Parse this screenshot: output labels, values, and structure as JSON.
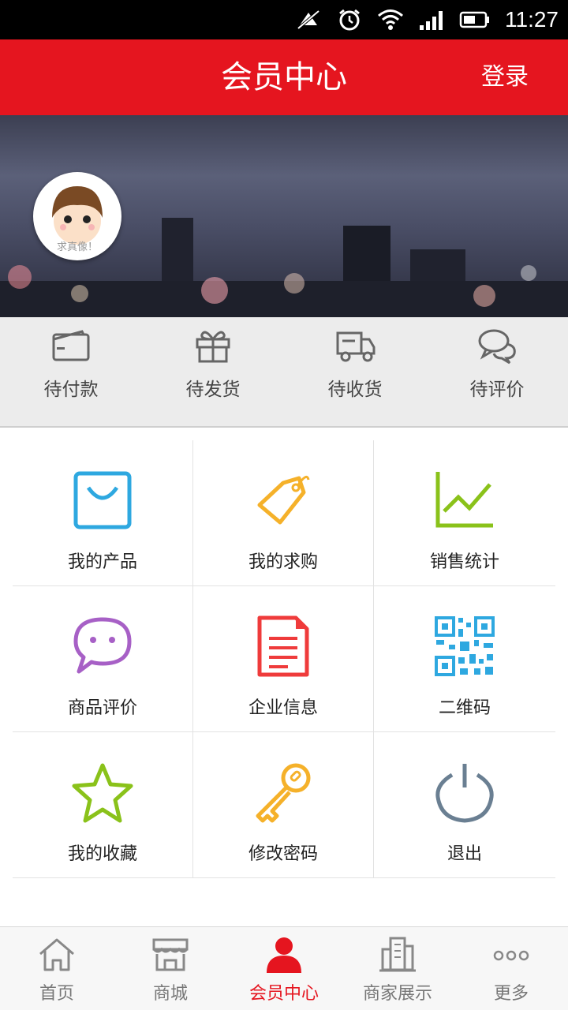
{
  "status_bar": {
    "time": "11:27"
  },
  "header": {
    "title": "会员中心",
    "login_label": "登录"
  },
  "profile": {
    "avatar_hint": "求真像！"
  },
  "orders": [
    {
      "label": "待付款",
      "icon": "wallet-icon"
    },
    {
      "label": "待发货",
      "icon": "gift-icon"
    },
    {
      "label": "待收货",
      "icon": "truck-icon"
    },
    {
      "label": "待评价",
      "icon": "chat-bubbles-icon"
    }
  ],
  "menu": [
    {
      "label": "我的产品",
      "icon": "shopping-bag-icon",
      "color": "#2ea8e0"
    },
    {
      "label": "我的求购",
      "icon": "price-tag-icon",
      "color": "#f5b12a"
    },
    {
      "label": "销售统计",
      "icon": "line-chart-icon",
      "color": "#8ac21a"
    },
    {
      "label": "商品评价",
      "icon": "speech-bubble-icon",
      "color": "#a760c6"
    },
    {
      "label": "企业信息",
      "icon": "document-icon",
      "color": "#ef3b3b"
    },
    {
      "label": "二维码",
      "icon": "qr-code-icon",
      "color": "#2ea8e0"
    },
    {
      "label": "我的收藏",
      "icon": "star-icon",
      "color": "#8ac21a"
    },
    {
      "label": "修改密码",
      "icon": "key-icon",
      "color": "#f5b12a"
    },
    {
      "label": "退出",
      "icon": "power-icon",
      "color": "#6a7f92"
    }
  ],
  "tabs": [
    {
      "label": "首页",
      "icon": "home-icon",
      "active": false
    },
    {
      "label": "商城",
      "icon": "store-icon",
      "active": false
    },
    {
      "label": "会员中心",
      "icon": "user-icon",
      "active": true
    },
    {
      "label": "商家展示",
      "icon": "building-icon",
      "active": false
    },
    {
      "label": "更多",
      "icon": "more-icon",
      "active": false
    }
  ],
  "colors": {
    "brand": "#e5151f",
    "tab_inactive": "#777777"
  }
}
